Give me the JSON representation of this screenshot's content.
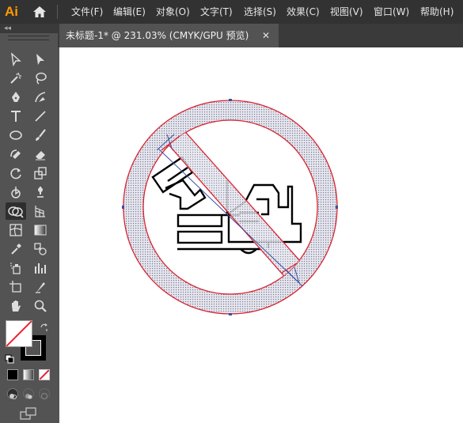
{
  "app": {
    "logo_text": "Ai",
    "accent_color": "#ff9a00"
  },
  "menu": {
    "items": [
      "文件(F)",
      "编辑(E)",
      "对象(O)",
      "文字(T)",
      "选择(S)",
      "效果(C)",
      "视图(V)",
      "窗口(W)",
      "帮助(H)"
    ]
  },
  "toolbox": {
    "collapse_glyph": "◂◂",
    "tools": [
      "selection-tool-icon",
      "direct-selection-tool-icon",
      "magic-wand-tool-icon",
      "lasso-tool-icon",
      "pen-tool-icon",
      "curvature-tool-icon",
      "type-tool-icon",
      "line-segment-tool-icon",
      "ellipse-tool-icon",
      "paintbrush-tool-icon",
      "shaper-tool-icon",
      "eraser-tool-icon",
      "rotate-tool-icon",
      "scale-tool-icon",
      "warp-tool-icon",
      "puppet-warp-tool-icon",
      "shape-builder-tool-icon",
      "perspective-grid-tool-icon",
      "mesh-tool-icon",
      "gradient-tool-icon",
      "eyedropper-tool-icon",
      "blend-tool-icon",
      "symbol-sprayer-tool-icon",
      "column-graph-tool-icon",
      "artboard-tool-icon",
      "slice-tool-icon",
      "hand-tool-icon",
      "zoom-tool-icon"
    ],
    "selected_tool": "shape-builder-tool-icon",
    "fill": "none",
    "stroke": "#000000"
  },
  "document": {
    "tab_title": "未标题-1* @ 231.03% (CMYK/GPU 预览)",
    "close_glyph": "✕"
  },
  "artwork": {
    "description_colors": {
      "ring_outline": "#d9232e",
      "ring_fill": "#c8c8d2",
      "line": "#000000",
      "path_guides": "#3b4fa0"
    }
  }
}
